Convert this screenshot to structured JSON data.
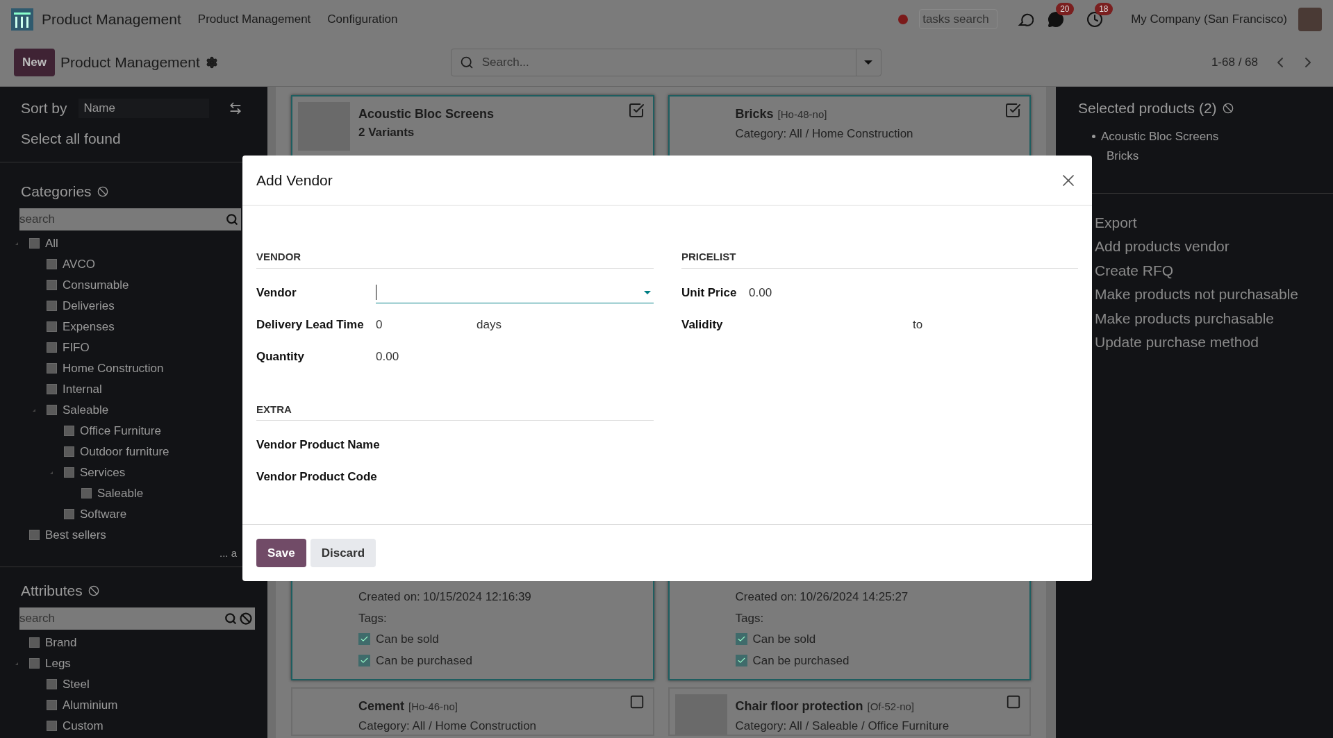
{
  "navbar": {
    "app_title": "Product Management",
    "menu": [
      "Product Management",
      "Configuration"
    ],
    "tasks_search": {
      "placeholder": "tasks search"
    },
    "messages_badge": "20",
    "activities_badge": "18",
    "company": "My Company (San Francisco)"
  },
  "control_panel": {
    "new_button": "New",
    "title": "Product Management",
    "search": {
      "placeholder": "Search..."
    },
    "pager": "1-68 / 68"
  },
  "sidebar": {
    "sort_label": "Sort by",
    "sort_value": "Name",
    "select_all": "Select all found",
    "categories": {
      "title": "Categories",
      "search": {
        "placeholder": "search"
      },
      "more": "... a",
      "items": [
        {
          "label": "All",
          "checked": false,
          "children": [
            {
              "label": "AVCO",
              "checked": false
            },
            {
              "label": "Consumable",
              "checked": false
            },
            {
              "label": "Deliveries",
              "checked": false
            },
            {
              "label": "Expenses",
              "checked": false
            },
            {
              "label": "FIFO",
              "checked": false
            },
            {
              "label": "Home Construction",
              "checked": false
            },
            {
              "label": "Internal",
              "checked": false
            },
            {
              "label": "Saleable",
              "checked": false,
              "children": [
                {
                  "label": "Office Furniture",
                  "checked": false
                },
                {
                  "label": "Outdoor furniture",
                  "checked": false
                },
                {
                  "label": "Services",
                  "checked": false,
                  "children": [
                    {
                      "label": "Saleable",
                      "checked": false
                    }
                  ]
                },
                {
                  "label": "Software",
                  "checked": false
                }
              ]
            }
          ]
        },
        {
          "label": "Best sellers",
          "checked": false
        }
      ]
    },
    "attributes": {
      "title": "Attributes",
      "search": {
        "placeholder": "search"
      },
      "items": [
        {
          "label": "Brand",
          "checked": false
        },
        {
          "label": "Legs",
          "checked": false,
          "children": [
            {
              "label": "Steel",
              "checked": false
            },
            {
              "label": "Aluminium",
              "checked": false
            },
            {
              "label": "Custom",
              "checked": false
            }
          ]
        }
      ]
    }
  },
  "cards": [
    {
      "name": "Acoustic Bloc Screens",
      "variants": "2 Variants",
      "image": true,
      "selected": true,
      "created_label": "Created on:",
      "created": "10/15/2024 12:16:39",
      "tags_label": "Tags:",
      "tags": [
        {
          "label": "Can be sold",
          "checked": true
        },
        {
          "label": "Can be purchased",
          "checked": true
        }
      ]
    },
    {
      "name": "Bricks",
      "code": "[Ho-48-no]",
      "category": "Category: All / Home Construction",
      "selected": true,
      "created_label": "Created on:",
      "created": "10/26/2024 14:25:27",
      "tags_label": "Tags:",
      "tags": [
        {
          "label": "Can be sold",
          "checked": true
        },
        {
          "label": "Can be purchased",
          "checked": true
        }
      ]
    },
    {
      "name": "Cement",
      "code": "[Ho-46-no]",
      "category": "Category: All / Home Construction",
      "selected": false
    },
    {
      "name": "Chair floor protection",
      "code": "[Of-52-no]",
      "category": "Category: All / Saleable / Office Furniture",
      "image": true,
      "selected": false
    }
  ],
  "selected_panel": {
    "title": "Selected products (2)",
    "items": [
      "Acoustic Bloc Screens",
      "Bricks"
    ],
    "actions": [
      "Export",
      "Add products vendor",
      "Create RFQ",
      "Make products not purchasable",
      "Make products purchasable",
      "Update purchase method"
    ]
  },
  "dialog": {
    "title": "Add Vendor",
    "vendor_section": {
      "title": "VENDOR",
      "fields": [
        {
          "label": "Vendor",
          "kind": "dropdown"
        },
        {
          "label": "Delivery Lead Time",
          "kind": "number",
          "value": "0",
          "unit": "days"
        },
        {
          "label": "Quantity",
          "kind": "number",
          "value": "0.00"
        }
      ]
    },
    "pricelist_section": {
      "title": "PRICELIST",
      "fields": [
        {
          "label": "Unit Price",
          "kind": "number",
          "value": "0.00"
        },
        {
          "label": "Validity",
          "kind": "range",
          "separator": "to"
        }
      ]
    },
    "extra_section": {
      "title": "EXTRA",
      "fields": [
        {
          "label": "Vendor Product Name"
        },
        {
          "label": "Vendor Product Code"
        }
      ]
    },
    "buttons": [
      {
        "label": "Save",
        "kind": "primary"
      },
      {
        "label": "Discard",
        "kind": "secondary"
      }
    ]
  }
}
